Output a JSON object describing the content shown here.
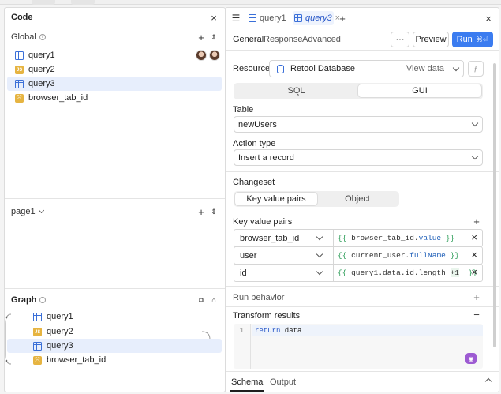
{
  "left": {
    "title": "Code",
    "global_label": "Global",
    "global_items": [
      {
        "name": "query1",
        "type": "query"
      },
      {
        "name": "query2",
        "type": "js"
      },
      {
        "name": "query3",
        "type": "query"
      },
      {
        "name": "browser_tab_id",
        "type": "variable"
      }
    ],
    "page_label": "page1",
    "graph_label": "Graph",
    "graph_items": [
      {
        "name": "query1",
        "type": "query"
      },
      {
        "name": "query2",
        "type": "js"
      },
      {
        "name": "query3",
        "type": "query"
      },
      {
        "name": "browser_tab_id",
        "type": "variable"
      }
    ]
  },
  "right": {
    "tabs": [
      {
        "label": "query1"
      },
      {
        "label": "query3"
      }
    ],
    "subtabs": [
      "General",
      "Response",
      "Advanced"
    ],
    "more_label": "···",
    "preview_label": "Preview",
    "run_label": "Run",
    "run_shortcut": "⌘⏎",
    "resource_label": "Resource",
    "resource_value": "Retool Database",
    "view_data_label": "View data",
    "mode_sql": "SQL",
    "mode_gui": "GUI",
    "table_label": "Table",
    "table_value": "newUsers",
    "action_label": "Action type",
    "action_value": "Insert a record",
    "changeset_label": "Changeset",
    "changeset_kv": "Key value pairs",
    "changeset_object": "Object",
    "kv_label": "Key value pairs",
    "kv_rows": [
      {
        "key": "browser_tab_id",
        "value_plain": "browser_tab_id.",
        "value_prop": "value"
      },
      {
        "key": "user",
        "value_plain": "current_user.",
        "value_prop": "fullName"
      },
      {
        "key": "id",
        "value_plain": "query1.data.id.length ",
        "value_prop": "+1"
      }
    ],
    "run_behavior_label": "Run behavior",
    "transform_label": "Transform results",
    "code_line_no": "1",
    "code_kw": "return",
    "code_rest": " data",
    "bottom_tabs": [
      "Schema",
      "Output"
    ]
  },
  "colors": {
    "accent": "#3b7cf0",
    "selected": "#e7eefc",
    "js_badge": "#e6b441"
  }
}
